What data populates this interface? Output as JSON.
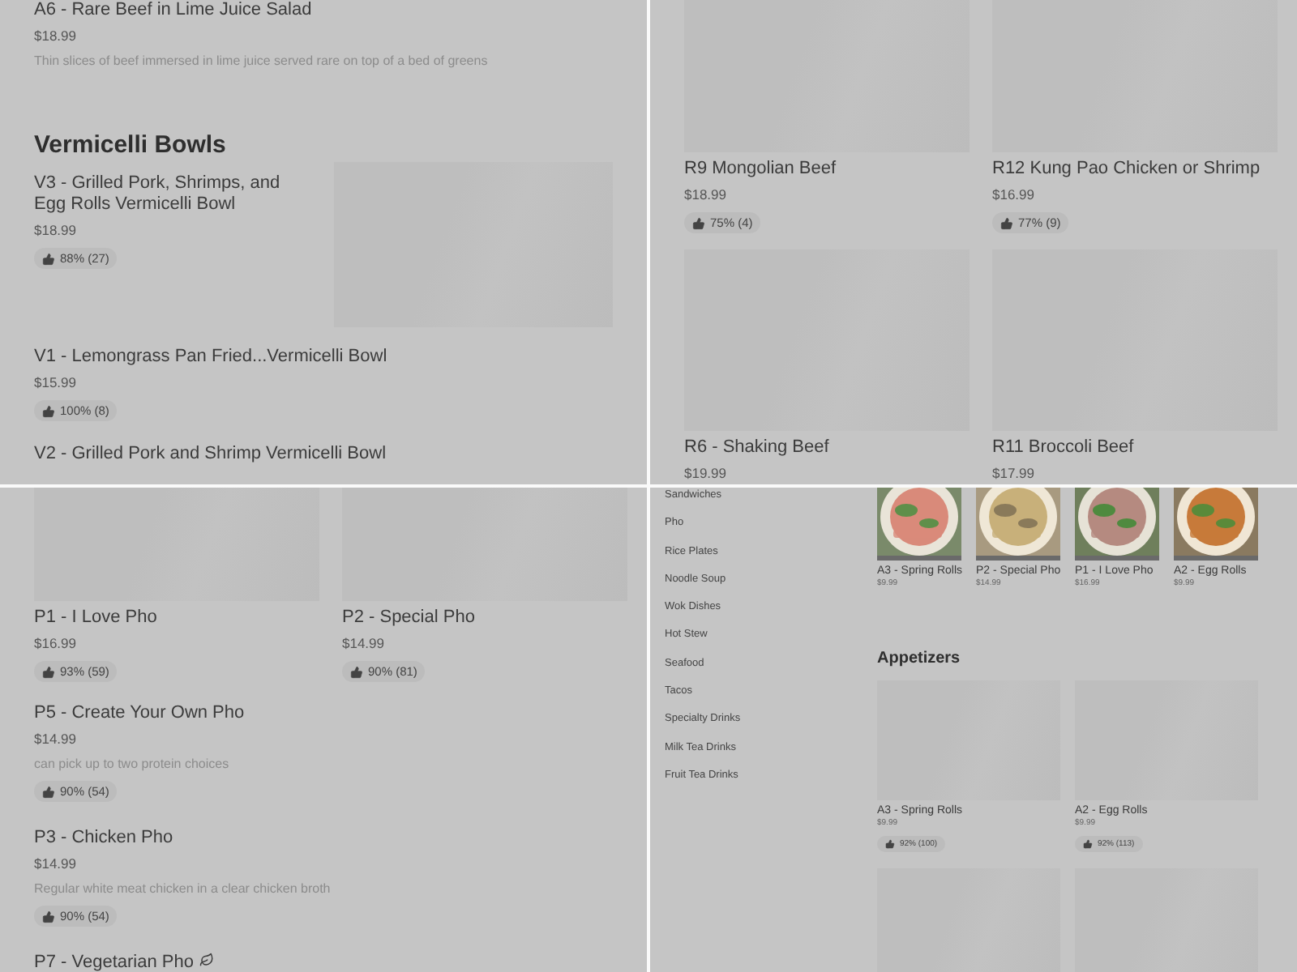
{
  "vermicelli_view": {
    "top_items": [
      {
        "kind": "text",
        "title": "A6 - Rare Beef in Lime Juice Salad",
        "price": "$18.99",
        "description": "Thin slices of beef immersed in lime juice served rare on top of a bed of greens"
      }
    ],
    "section": "Vermicelli Bowls",
    "items": [
      {
        "kind": "with_image",
        "title": "V3 - Grilled Pork, Shrimps, and Egg Rolls Vermicelli Bowl",
        "price": "$18.99",
        "rating": "88% (27)"
      },
      {
        "kind": "text",
        "title": "V1 - Lemongrass Pan Fried...Vermicelli Bowl",
        "price": "$15.99",
        "rating": "100% (8)"
      },
      {
        "kind": "text",
        "title": "V2 - Grilled Pork and Shrimp Vermicelli Bowl"
      }
    ]
  },
  "rice_plates_view": {
    "cards": [
      {
        "title": "R9 Mongolian Beef",
        "price": "$18.99",
        "rating": "75% (4)"
      },
      {
        "title": "R12 Kung Pao Chicken or Shrimp",
        "price": "$16.99",
        "rating": "77% (9)"
      },
      {
        "title": "R6 - Shaking Beef",
        "price": "$19.99"
      },
      {
        "title": "R11 Broccoli Beef",
        "price": "$17.99"
      }
    ]
  },
  "pho_view": {
    "cards": [
      {
        "title": "P1 - I Love Pho",
        "price": "$16.99",
        "rating": "93% (59)"
      },
      {
        "title": "P2 - Special Pho",
        "price": "$14.99",
        "rating": "90% (81)"
      }
    ],
    "items": [
      {
        "kind": "text",
        "title": "P5 - Create Your Own Pho",
        "price": "$14.99",
        "description": "can pick up to two protein choices",
        "rating": "90% (54)"
      },
      {
        "kind": "text",
        "title": "P3 - Chicken Pho",
        "price": "$14.99",
        "description": "Regular white meat chicken in a clear chicken broth",
        "rating": "90% (54)"
      },
      {
        "kind": "vegetarian",
        "title": "P7 - Vegetarian Pho"
      }
    ]
  },
  "category_view": {
    "categories": [
      "Sandwiches",
      "Pho",
      "Rice Plates",
      "Noodle Soup",
      "Wok Dishes",
      "Hot Stew",
      "Seafood",
      "Tacos",
      "Specialty Drinks",
      "Milk Tea Drinks",
      "Fruit Tea Drinks"
    ],
    "featured": [
      {
        "kind": "picture",
        "title": "A3 - Spring Rolls",
        "price": "$9.99"
      },
      {
        "kind": "picture",
        "title": "P2 - Special Pho",
        "price": "$14.99"
      },
      {
        "kind": "picture",
        "title": "P1 - I Love Pho",
        "price": "$16.99"
      },
      {
        "kind": "picture",
        "title": "A2 - Egg Rolls",
        "price": "$9.99"
      }
    ],
    "section": "Appetizers",
    "cards": [
      {
        "kind": "full",
        "title": "A3 - Spring Rolls",
        "price": "$9.99",
        "rating": "92% (100)"
      },
      {
        "kind": "full",
        "title": "A2 - Egg Rolls",
        "price": "$9.99",
        "rating": "92% (113)"
      },
      {
        "kind": "image_only"
      },
      {
        "kind": "image_only"
      }
    ]
  }
}
